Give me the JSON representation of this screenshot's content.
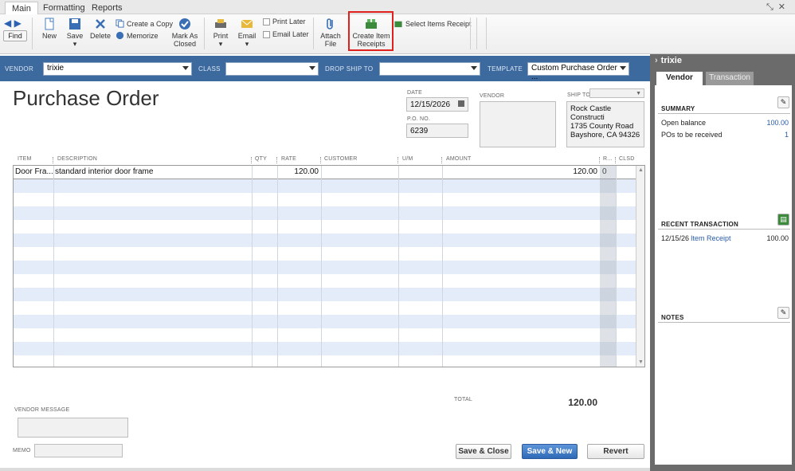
{
  "tabs": [
    "Main",
    "Formatting",
    "Reports"
  ],
  "toolbar": {
    "find": "Find",
    "new": "New",
    "save": "Save",
    "delete": "Delete",
    "create_copy": "Create a Copy",
    "memorize": "Memorize",
    "mark_as": "Mark As",
    "closed": "Closed",
    "print": "Print",
    "email": "Email",
    "print_later": "Print Later",
    "email_later": "Email Later",
    "attach": "Attach",
    "file": "File",
    "create_item": "Create Item",
    "receipts": "Receipts",
    "select_items_receipt": "Select Items Receipt"
  },
  "header": {
    "vendor_label": "VENDOR",
    "vendor_value": "trixie",
    "class_label": "CLASS",
    "class_value": "",
    "drop_ship_label": "DROP SHIP TO",
    "drop_ship_value": "",
    "template_label": "TEMPLATE",
    "template_value": "Custom Purchase Order ..."
  },
  "form": {
    "title": "Purchase Order",
    "date_label": "DATE",
    "date_value": "12/15/2026",
    "po_label": "P.O. NO.",
    "po_value": "6239",
    "vendor_label": "VENDOR",
    "ship_to_label": "SHIP TO",
    "ship_to_lines": [
      "Rock Castle Constructi",
      "1735 County Road",
      "Bayshore, CA 94326"
    ]
  },
  "grid": {
    "columns": [
      "ITEM",
      "DESCRIPTION",
      "QTY",
      "RATE",
      "CUSTOMER",
      "U/M",
      "AMOUNT",
      "R...",
      "CLSD"
    ],
    "rows": [
      {
        "item": "Door Fra...",
        "description": "standard interior door frame",
        "qty": "",
        "rate": "120.00",
        "customer": "",
        "um": "",
        "amount": "120.00",
        "r": "0",
        "clsd": ""
      }
    ]
  },
  "footer": {
    "total_label": "TOTAL",
    "total_value": "120.00",
    "vendor_message_label": "VENDOR MESSAGE",
    "memo_label": "MEMO",
    "save_close": "Save & Close",
    "save_new": "Save & New",
    "revert": "Revert"
  },
  "right_panel": {
    "name": "trixie",
    "tab_vendor": "Vendor",
    "tab_transaction": "Transaction",
    "summary_label": "SUMMARY",
    "open_balance_label": "Open balance",
    "open_balance_value": "100.00",
    "pos_label": "POs to be received",
    "pos_value": "1",
    "recent_label": "RECENT TRANSACTION",
    "recent_date": "12/15/26",
    "recent_type": "Item Receipt",
    "recent_amount": "100.00",
    "notes_label": "NOTES"
  }
}
